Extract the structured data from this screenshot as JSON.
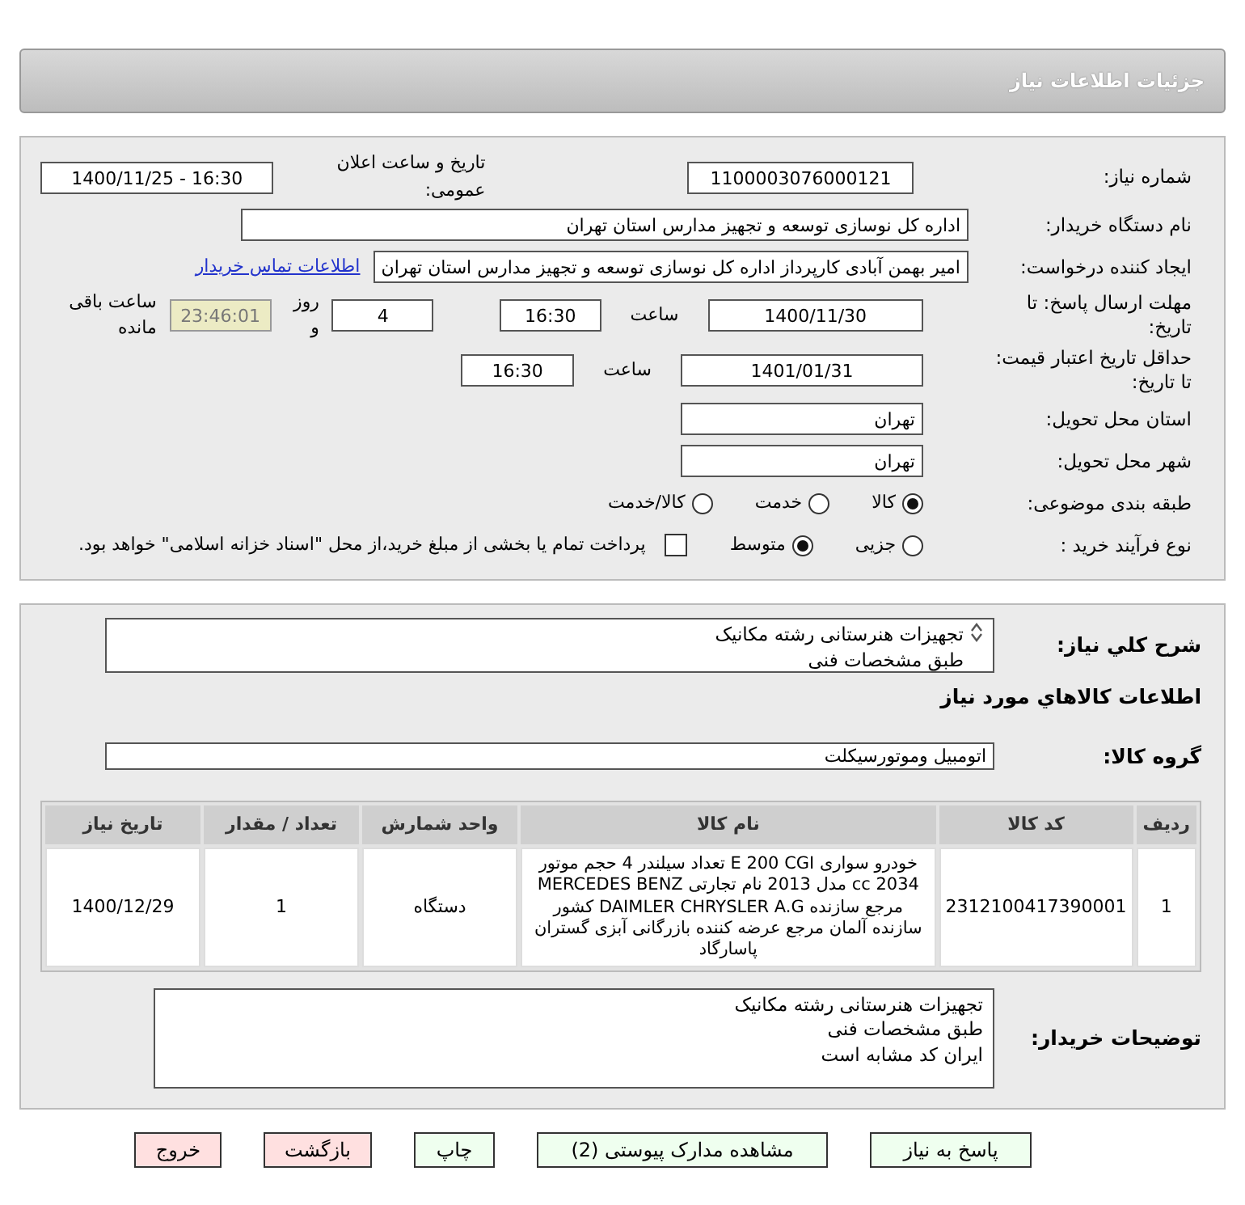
{
  "header": {
    "title": "جزئیات اطلاعات نیاز"
  },
  "need_number": {
    "label": "شماره نیاز:",
    "value": "1100003076000121"
  },
  "announce": {
    "label": "تاریخ و ساعت اعلان عمومی:",
    "value": "16:30 - 1400/11/25"
  },
  "buyer": {
    "label": "نام دستگاه خریدار:",
    "value": "اداره کل نوسازی  توسعه و تجهیز مدارس استان تهران"
  },
  "requester": {
    "label": "ایجاد کننده درخواست:",
    "value": "امیر بهمن آبادی کارپرداز اداره کل نوسازی  توسعه و تجهیز مدارس استان تهران",
    "link": "اطلاعات تماس خریدار"
  },
  "deadline": {
    "label": "مهلت ارسال پاسخ: تا تاریخ:",
    "date": "1400/11/30",
    "time_label": "ساعت",
    "time": "16:30",
    "days": "4",
    "days_label": "روز و",
    "remaining": "23:46:01",
    "remaining_label": "ساعت باقی مانده"
  },
  "validity": {
    "label": "حداقل تاریخ اعتبار قیمت: تا تاریخ:",
    "date": "1401/01/31",
    "time_label": "ساعت",
    "time": "16:30"
  },
  "province": {
    "label": "استان محل تحویل:",
    "value": "تهران"
  },
  "city": {
    "label": "شهر محل تحویل:",
    "value": "تهران"
  },
  "category": {
    "label": "طبقه بندی موضوعی:",
    "options": [
      {
        "label": "کالا",
        "selected": true
      },
      {
        "label": "خدمت",
        "selected": false
      },
      {
        "label": "کالا/خدمت",
        "selected": false
      }
    ]
  },
  "process": {
    "label": "نوع فرآیند خرید :",
    "options": [
      {
        "label": "جزیی",
        "selected": false
      },
      {
        "label": "متوسط",
        "selected": true
      }
    ],
    "checkbox": {
      "checked": false,
      "text": "پرداخت تمام یا بخشی از مبلغ خرید،از محل \"اسناد خزانه اسلامی\" خواهد بود."
    }
  },
  "description": {
    "label": "شرح کلي نياز:",
    "lines": [
      "تجهیزات هنرستانی رشته مکانیک",
      "طبق مشخصات فنی"
    ]
  },
  "goods_title": "اطلاعات کالاهاي مورد نياز",
  "goods_group": {
    "label": "گروه کالا:",
    "value": "اتومبیل وموتورسیکلت"
  },
  "table": {
    "columns": [
      "ردیف",
      "کد کالا",
      "نام کالا",
      "واحد شمارش",
      "تعداد / مقدار",
      "تاریخ نیاز"
    ],
    "rows": [
      [
        "1",
        "2312100417390001",
        "خودرو سواری E 200 CGI تعداد سیلندر 4 حجم موتور 2034 cc مدل 2013 نام تجارتی MERCEDES BENZ مرجع سازنده DAIMLER CHRYSLER A.G کشور سازنده آلمان مرجع عرضه کننده بازرگانی آبزی گستران پاسارگاد",
        "دستگاه",
        "1",
        "1400/12/29"
      ]
    ]
  },
  "buyer_notes": {
    "label": "توضیحات خریدار:",
    "lines": [
      "تجهیزات هنرستانی رشته مکانیک",
      "طبق مشخصات فنی",
      "ایران کد مشابه است"
    ]
  },
  "buttons": [
    {
      "label": "پاسخ به نیاز",
      "kind": "green"
    },
    {
      "label": "مشاهده مدارک پیوستی (2)",
      "kind": "green"
    },
    {
      "label": "چاپ",
      "kind": "green"
    },
    {
      "label": "بازگشت",
      "kind": "red"
    },
    {
      "label": "خروج",
      "kind": "red"
    }
  ]
}
